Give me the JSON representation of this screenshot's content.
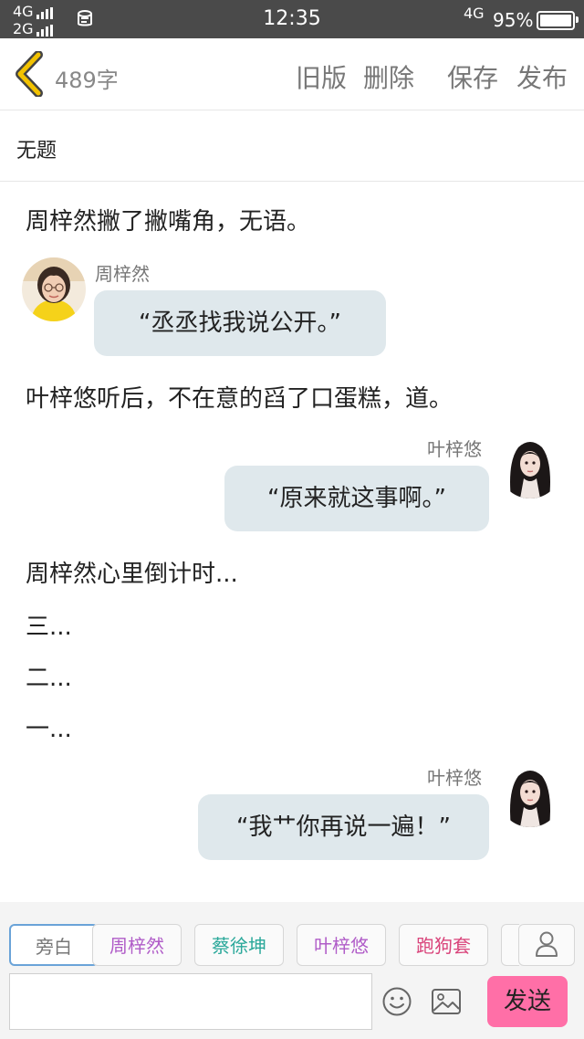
{
  "status_bar": {
    "network_top": "4G",
    "network_bottom": "2G",
    "time": "12:35",
    "network_right": "4G",
    "battery": "95%"
  },
  "toolbar": {
    "word_count": "489字",
    "old_version": "旧版",
    "delete": "删除",
    "save": "保存",
    "publish": "发布"
  },
  "document": {
    "title": "无题"
  },
  "story": [
    {
      "type": "narration",
      "text": "周梓然撇了撇嘴角，无语。"
    },
    {
      "type": "dialog",
      "side": "left",
      "speaker": "周梓然",
      "text": "“丞丞找我说公开。”",
      "avatar": "girl-glasses-yellow-avatar"
    },
    {
      "type": "narration",
      "text": "叶梓悠听后，不在意的舀了口蛋糕，道。"
    },
    {
      "type": "dialog",
      "side": "right",
      "speaker": "叶梓悠",
      "text": "“原来就这事啊。”",
      "avatar": "girl-long-hair-avatar"
    },
    {
      "type": "narration",
      "text": "周梓然心里倒计时..."
    },
    {
      "type": "narration",
      "text": "三..."
    },
    {
      "type": "narration",
      "text": "二..."
    },
    {
      "type": "narration",
      "text": "一..."
    },
    {
      "type": "dialog",
      "side": "right",
      "speaker": "叶梓悠",
      "text": "“我艹你再说一遍！”",
      "avatar": "girl-long-hair-avatar"
    }
  ],
  "composer": {
    "roles": [
      {
        "label": "旁白",
        "color": "#777777"
      },
      {
        "label": "周梓然",
        "color": "#b05cc8"
      },
      {
        "label": "蔡徐坤",
        "color": "#2aa89a"
      },
      {
        "label": "叶梓悠",
        "color": "#b05cc8"
      },
      {
        "label": "跑狗套",
        "color": "#d9437a"
      }
    ],
    "input_value": "",
    "send": "发送"
  },
  "colors": {
    "accent_back": "#f2c200",
    "bubble": "#dfe8ec",
    "send_button": "#ff6fa7"
  }
}
